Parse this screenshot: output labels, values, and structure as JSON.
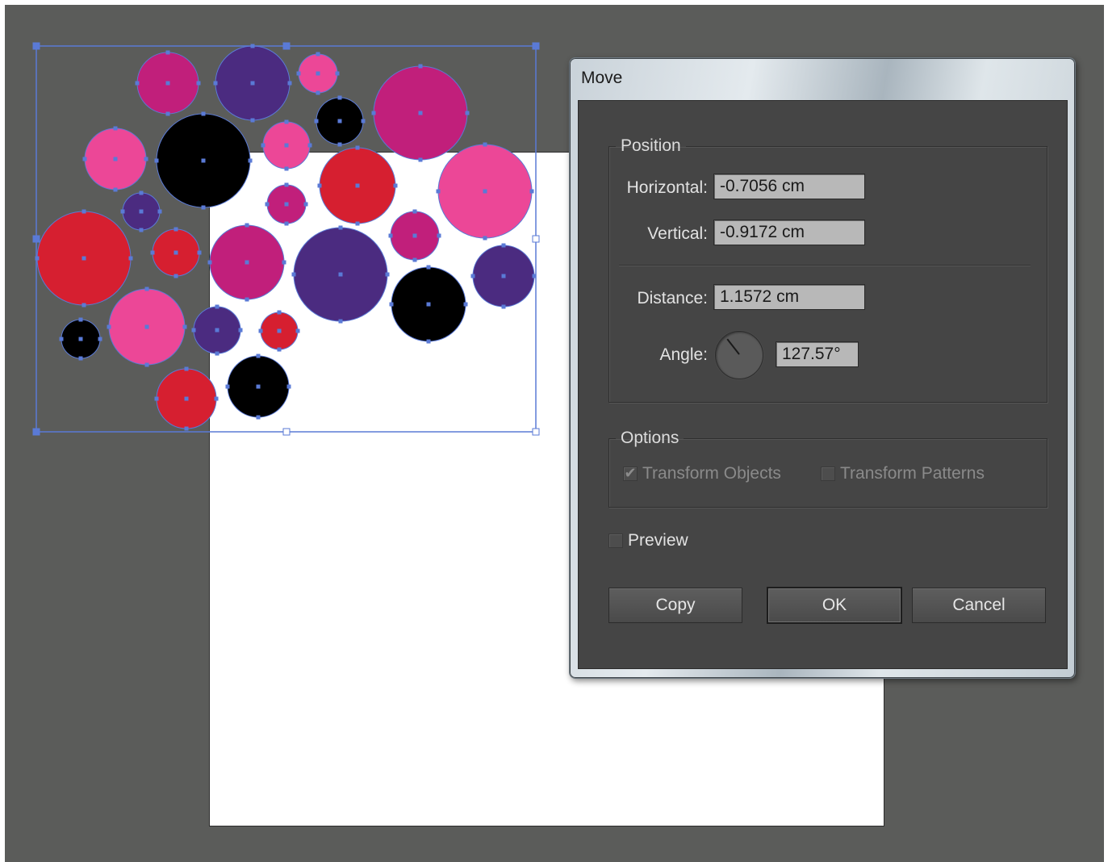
{
  "canvas": {
    "workspace_color": "#5b5c5a",
    "artboard_color": "#ffffff",
    "selection_color": "#5a7ad6",
    "circle_colors": {
      "magenta": "#c11f7b",
      "purple": "#4b2b80",
      "pink": "#ec4797",
      "red": "#d61f30",
      "black": "#000000"
    }
  },
  "dialog": {
    "title": "Move",
    "position": {
      "legend": "Position",
      "horizontal_label": "Horizontal:",
      "horizontal_value": "-0.7056 cm",
      "vertical_label": "Vertical:",
      "vertical_value": "-0.9172 cm",
      "distance_label": "Distance:",
      "distance_value": "1.1572 cm",
      "angle_label": "Angle:",
      "angle_value": "127.57°"
    },
    "options": {
      "legend": "Options",
      "transform_objects_label": "Transform Objects",
      "transform_objects_checked": true,
      "transform_patterns_label": "Transform Patterns",
      "transform_patterns_checked": false
    },
    "preview_label": "Preview",
    "preview_checked": false,
    "buttons": {
      "copy": "Copy",
      "ok": "OK",
      "cancel": "Cancel"
    }
  }
}
